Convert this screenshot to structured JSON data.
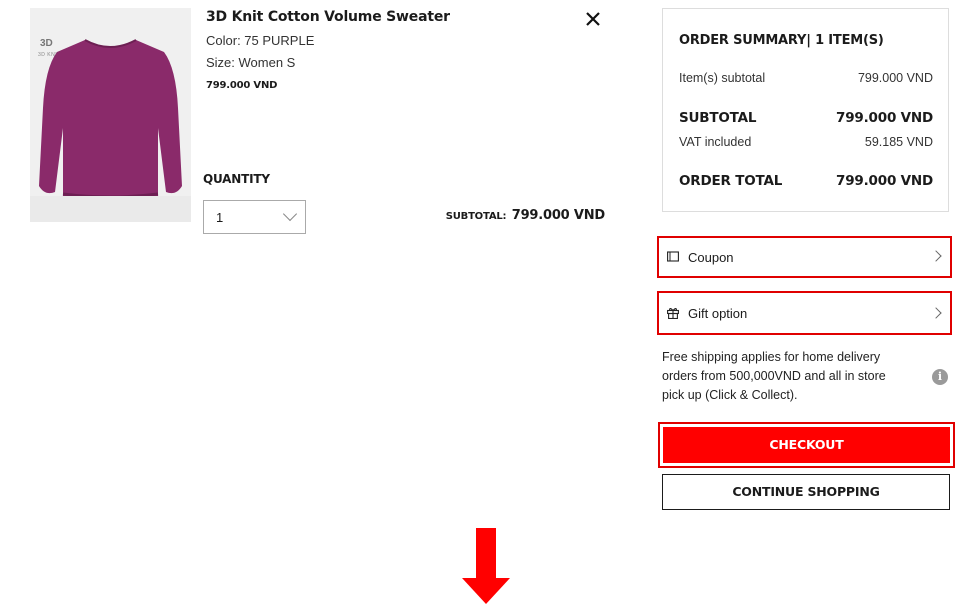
{
  "product": {
    "name": "3D Knit Cotton Volume Sweater",
    "color": "Color: 75 PURPLE",
    "size": "Size: Women S",
    "price": "799.000 VND",
    "image_badge": "3D KNIT",
    "image_color": "#8a2a6a"
  },
  "quantity": {
    "label": "QUANTITY",
    "value": "1"
  },
  "line_subtotal": {
    "label": "SUBTOTAL:",
    "value": "799.000 VND"
  },
  "summary": {
    "title": "ORDER SUMMARY| 1 ITEM(S)",
    "items_subtotal_label": "Item(s) subtotal",
    "items_subtotal_value": "799.000 VND",
    "subtotal_label": "SUBTOTAL",
    "subtotal_value": "799.000 VND",
    "vat_label": "VAT included",
    "vat_value": "59.185 VND",
    "order_total_label": "ORDER TOTAL",
    "order_total_value": "799.000 VND"
  },
  "options": {
    "coupon_label": "Coupon",
    "gift_label": "Gift option"
  },
  "shipping_note": "Free shipping applies for home delivery orders from 500,000VND and all in store pick up (Click & Collect).",
  "buttons": {
    "checkout": "CHECKOUT",
    "continue": "CONTINUE SHOPPING"
  },
  "icons": {
    "close": "close-icon",
    "coupon": "ticket-icon",
    "gift": "gift-icon",
    "info": "info-icon",
    "chevron": "chevron-right-icon",
    "arrow": "arrow-down-icon"
  },
  "colors": {
    "accent": "#ff0000",
    "highlight": "#e00000",
    "text": "#1b1b1b"
  }
}
